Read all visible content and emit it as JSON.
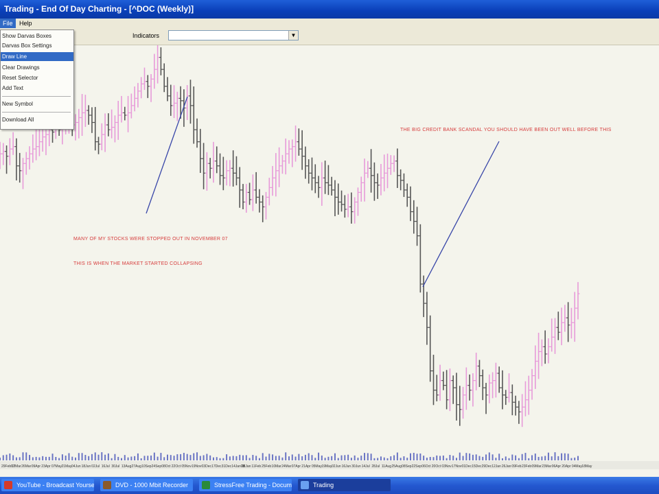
{
  "window": {
    "title": "Trading - End Of Day Charting - [^DOC (Weekly)]"
  },
  "menubar": {
    "items": [
      "File",
      "Help"
    ]
  },
  "toolbar": {
    "indicators_label": "Indicators",
    "indicators_value": ""
  },
  "context_menu": {
    "items": [
      "Show Darvas Boxes",
      "Darvas Box Settings",
      "Draw Line",
      "Clear Drawings",
      "Reset Selector",
      "Add Text",
      "New Symbol",
      "Download All"
    ],
    "highlighted": "Draw Line"
  },
  "annotations": [
    "MANY OF MY STOCKS WERE STOPPED OUT IN NOVEMBER 07",
    "THIS IS WHEN THE MARKET STARTED COLLAPSING",
    "THE BIG CREDIT BANK SCANDAL YOU SHOULD HAVE BEEN OUT WELL BEFORE THIS"
  ],
  "colors": {
    "up_bar": "#e79ad9",
    "down_bar": "#555555",
    "annotation": "#d63a3a",
    "trend_line": "#3846a8",
    "volume": "#6a74c4"
  },
  "chart_data": {
    "type": "ohlc",
    "x_axis_labels": [
      "29Feb07",
      "12Mar",
      "26Mar",
      "09Apr",
      "23Apr",
      "07May",
      "21May",
      "04Jun",
      "18Jun",
      "02Jul",
      "16Jul",
      "30Jul",
      "13Aug",
      "27Aug",
      "10Sep",
      "24Sep",
      "08Oct",
      "22Oct",
      "05Nov",
      "19Nov",
      "03Dec",
      "17Dec",
      "31Dec",
      "14Jan08",
      "28Jan",
      "11Feb",
      "25Feb",
      "10Mar",
      "24Mar",
      "07Apr",
      "21Apr",
      "05May",
      "19May",
      "02Jun",
      "16Jun",
      "30Jun",
      "14Jul",
      "28Jul",
      "11Aug",
      "25Aug",
      "08Sep",
      "22Sep",
      "06Oct",
      "20Oct",
      "03Nov",
      "17Nov",
      "01Dec",
      "15Dec",
      "29Dec",
      "12Jan",
      "26Jan",
      "09Feb",
      "23Feb",
      "09Mar",
      "23Mar",
      "06Apr",
      "20Apr",
      "04May",
      "18May"
    ],
    "close": [
      50,
      51,
      49,
      52,
      53,
      45,
      43,
      46,
      48,
      50,
      52,
      53,
      55,
      57,
      58,
      60,
      59,
      61,
      60,
      62,
      63,
      64,
      62,
      63,
      65,
      67,
      68,
      66,
      63,
      55,
      54,
      58,
      62,
      60,
      61,
      63,
      66,
      67,
      66,
      67,
      70,
      73,
      76,
      79,
      80,
      78,
      81,
      85,
      90,
      85,
      78,
      74,
      70,
      71,
      73,
      72,
      69,
      74,
      70,
      60,
      55,
      48,
      42,
      46,
      44,
      47,
      45,
      41,
      40,
      43,
      44,
      42,
      40,
      35,
      30,
      34,
      31,
      35,
      32,
      30,
      28,
      32,
      36,
      40,
      43,
      45,
      47,
      50,
      52,
      53,
      55,
      52,
      49,
      45,
      42,
      40,
      38,
      36,
      40,
      38,
      37,
      35,
      32,
      30,
      29,
      27,
      28,
      26,
      30,
      34,
      38,
      42,
      44,
      41,
      38,
      37,
      40,
      42,
      44,
      46,
      47,
      41,
      39,
      35,
      32,
      26,
      22,
      16,
      -4,
      -12,
      -22,
      -40,
      -48,
      -50,
      -44,
      -46,
      -52,
      -44,
      -47,
      -54,
      -56,
      -50,
      -46,
      -48,
      -44,
      -38,
      -42,
      -47,
      -50,
      -45,
      -44,
      -41,
      -47,
      -50,
      -51,
      -49,
      -53,
      -55,
      -57,
      -55,
      -52,
      -48,
      -42,
      -36,
      -32,
      -30,
      -33,
      -30,
      -26,
      -22,
      -24,
      -20,
      -18,
      -21,
      -20,
      -14,
      -8
    ]
  }
}
